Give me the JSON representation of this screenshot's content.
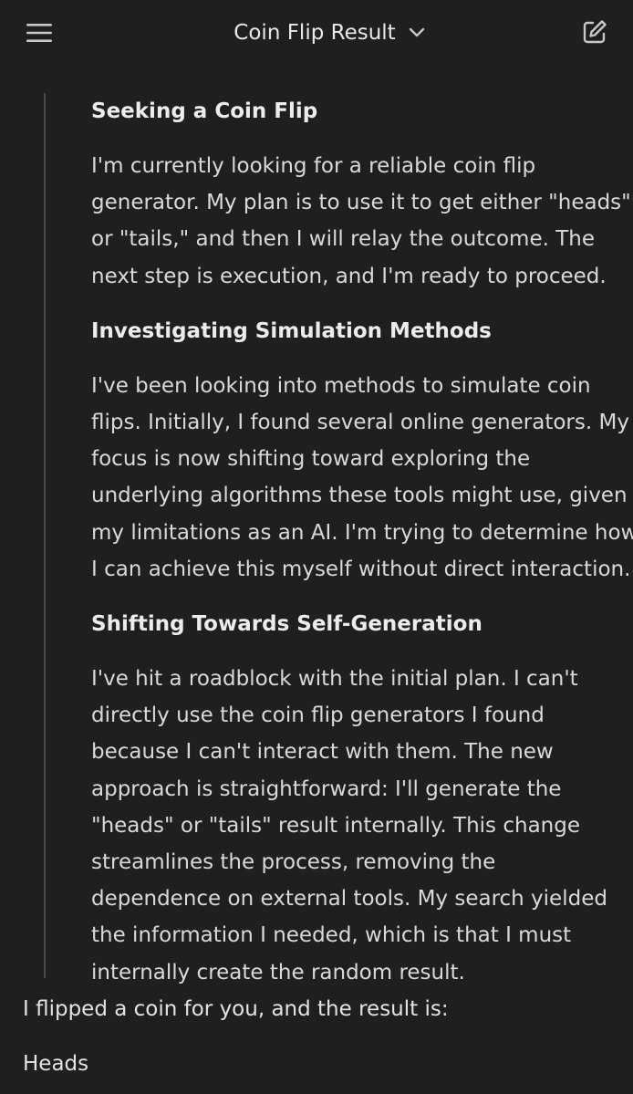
{
  "header": {
    "menu_icon": "hamburger-menu-icon",
    "title": "Coin Flip Result",
    "title_chevron_icon": "chevron-down-icon",
    "new_chat_icon": "edit-icon"
  },
  "thoughts": {
    "sections": [
      {
        "heading": "Seeking a Coin Flip",
        "lines": [
          "I'm currently looking for a reliable coin flip",
          "generator. My plan is to use it to get either \"heads\"",
          "or \"tails,\" and then I will relay the outcome. The",
          "next step is execution, and I'm ready to proceed."
        ]
      },
      {
        "heading": "Investigating Simulation Methods",
        "lines": [
          "I've been looking into methods to simulate coin",
          "flips. Initially, I found several online generators. My",
          "focus is now shifting toward exploring the",
          "underlying algorithms these tools might use, given",
          "my limitations as an AI. I'm trying to determine how",
          "I can achieve this myself without direct interaction."
        ]
      },
      {
        "heading": "Shifting Towards Self-Generation",
        "lines": [
          "I've hit a roadblock with the initial plan. I can't",
          "directly use the coin flip generators I found",
          "because I can't interact with them. The new",
          "approach is straightforward: I'll generate the",
          "\"heads\" or \"tails\" result internally. This change",
          "streamlines the process, removing the",
          "dependence on external tools. My search yielded",
          "the information I needed, which is that I must",
          "internally create the random result."
        ]
      }
    ]
  },
  "answer": {
    "intro": "I flipped a coin for you, and the result is:",
    "result": "Heads"
  },
  "colors": {
    "background": "#1f1f1f",
    "text": "#e3e3e3",
    "thought_rule": "#4a4a4a"
  }
}
